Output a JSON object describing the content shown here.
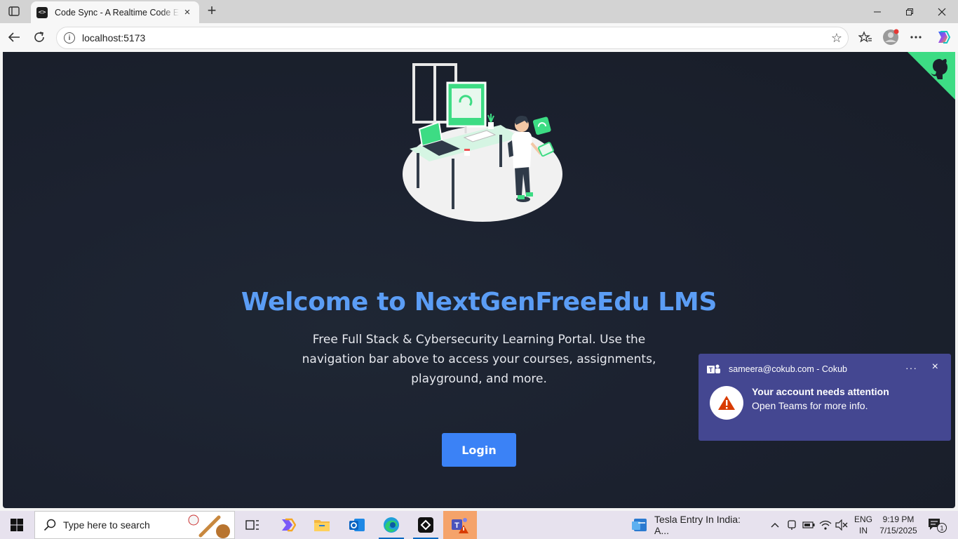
{
  "browser": {
    "tab": {
      "title": "Code Sync - A Realtime Code Editor",
      "favicon": "code-icon",
      "close": "×"
    },
    "new_tab": "+",
    "address": "localhost:5173",
    "window_controls": [
      "minimize-icon",
      "restore-icon",
      "close-icon"
    ]
  },
  "page": {
    "title": "Welcome to NextGenFreeEdu LMS",
    "description": "Free Full Stack & Cybersecurity Learning Portal. Use the navigation bar above to access your courses, assignments, playground, and more.",
    "login_label": "Login",
    "accent_color": "#5b9df5",
    "button_color": "#3b82f6",
    "ribbon_color": "#3ddc84"
  },
  "notification": {
    "source": "sameera@cokub.com - Cokub",
    "more": "···",
    "close": "×",
    "title": "Your account needs attention",
    "body": "Open Teams for more info."
  },
  "taskbar": {
    "search_placeholder": "Type here to search",
    "news_text": "Tesla Entry In India: A...",
    "language": [
      "ENG",
      "IN"
    ],
    "time": "9:19 PM",
    "date": "7/15/2025",
    "notification_count": "1"
  }
}
